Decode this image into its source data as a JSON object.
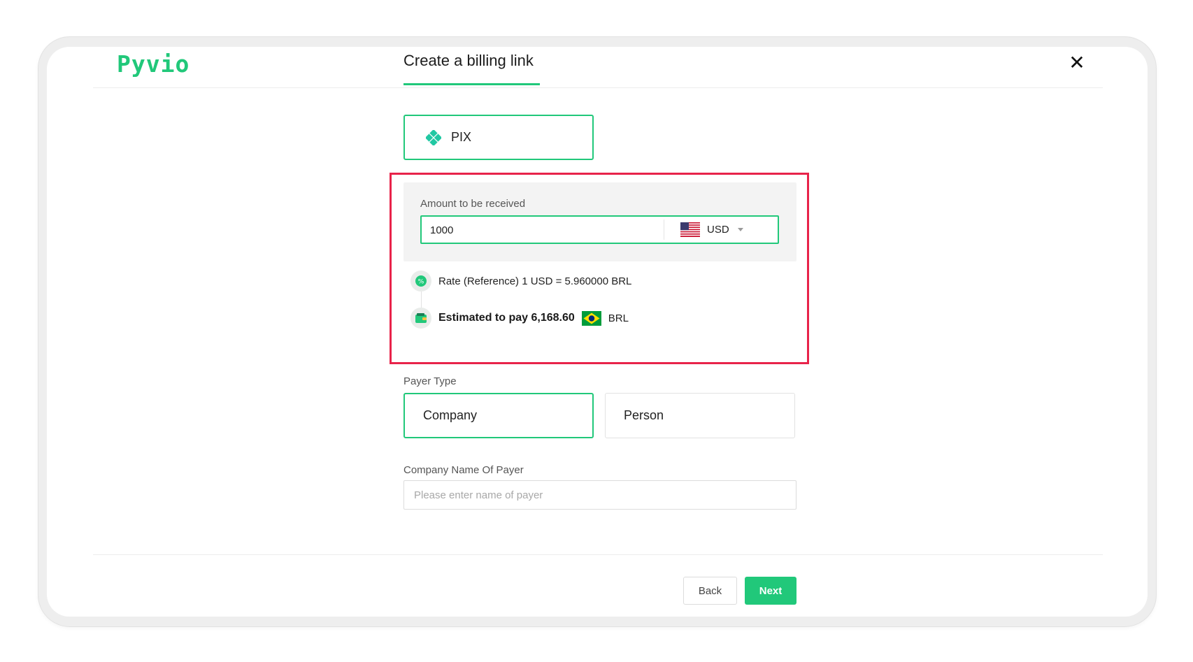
{
  "header": {
    "logo_text": "Pyvio",
    "title": "Create a billing link",
    "close_label": "✕"
  },
  "payment_method": {
    "icon": "pix-icon",
    "label": "PIX",
    "selected": true
  },
  "amount": {
    "label": "Amount to be received",
    "value": "1000",
    "currency": {
      "flag": "us-flag-icon",
      "code": "USD"
    }
  },
  "rate": {
    "icon": "rate-icon",
    "text": "Rate (Reference) 1 USD = 5.960000 BRL"
  },
  "estimate": {
    "icon": "wallet-icon",
    "text": "Estimated to pay 6,168.60",
    "flag": "brazil-flag-icon",
    "currency": "BRL"
  },
  "payer_type": {
    "label": "Payer Type",
    "options": [
      {
        "label": "Company",
        "selected": true
      },
      {
        "label": "Person",
        "selected": false
      }
    ]
  },
  "payer_name": {
    "label": "Company Name Of Payer",
    "value": "",
    "placeholder": "Please enter name of payer"
  },
  "footer": {
    "back_label": "Back",
    "next_label": "Next"
  },
  "colors": {
    "accent": "#21c87a",
    "highlight": "#e8234a"
  }
}
